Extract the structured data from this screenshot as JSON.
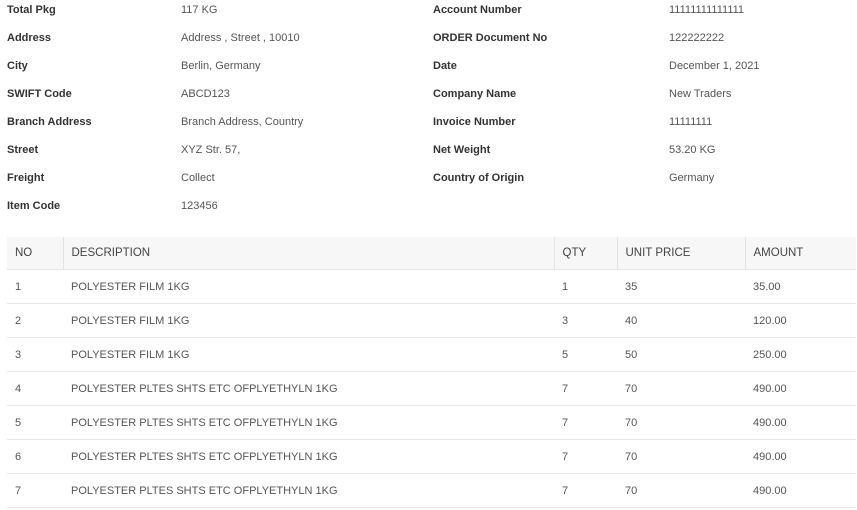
{
  "details": [
    {
      "label1": "Total Pkg",
      "value1": "117 KG",
      "label2": "Account Number",
      "value2": "11111111111111"
    },
    {
      "label1": "Address",
      "value1": "Address , Street , 10010",
      "label2": "ORDER Document No",
      "value2": "122222222"
    },
    {
      "label1": "City",
      "value1": "Berlin, Germany",
      "label2": "Date",
      "value2": "December 1, 2021"
    },
    {
      "label1": "SWIFT Code",
      "value1": "ABCD123",
      "label2": "Company Name",
      "value2": "New Traders"
    },
    {
      "label1": "Branch Address",
      "value1": "Branch Address, Country",
      "label2": "Invoice Number",
      "value2": "11111111"
    },
    {
      "label1": "Street",
      "value1": "XYZ Str. 57,",
      "label2": "Net Weight",
      "value2": "53.20 KG"
    },
    {
      "label1": "Freight",
      "value1": "Collect",
      "label2": "Country of Origin",
      "value2": "Germany"
    },
    {
      "label1": "Item Code",
      "value1": "123456",
      "label2": "",
      "value2": ""
    }
  ],
  "table": {
    "headers": [
      "NO",
      "DESCRIPTION",
      "QTY",
      "UNIT PRICE",
      "AMOUNT"
    ],
    "rows": [
      [
        "1",
        "POLYESTER FILM 1KG",
        "1",
        "35",
        "35.00"
      ],
      [
        "2",
        "POLYESTER FILM 1KG",
        "3",
        "40",
        "120.00"
      ],
      [
        "3",
        "POLYESTER FILM 1KG",
        "5",
        "50",
        "250.00"
      ],
      [
        "4",
        "POLYESTER PLTES SHTS ETC OFPLYETHYLN 1KG",
        "7",
        "70",
        "490.00"
      ],
      [
        "5",
        "POLYESTER PLTES SHTS ETC OFPLYETHYLN 1KG",
        "7",
        "70",
        "490.00"
      ],
      [
        "6",
        "POLYESTER PLTES SHTS ETC OFPLYETHYLN 1KG",
        "7",
        "70",
        "490.00"
      ],
      [
        "7",
        "POLYESTER PLTES SHTS ETC OFPLYETHYLN 1KG",
        "7",
        "70",
        "490.00"
      ]
    ]
  }
}
